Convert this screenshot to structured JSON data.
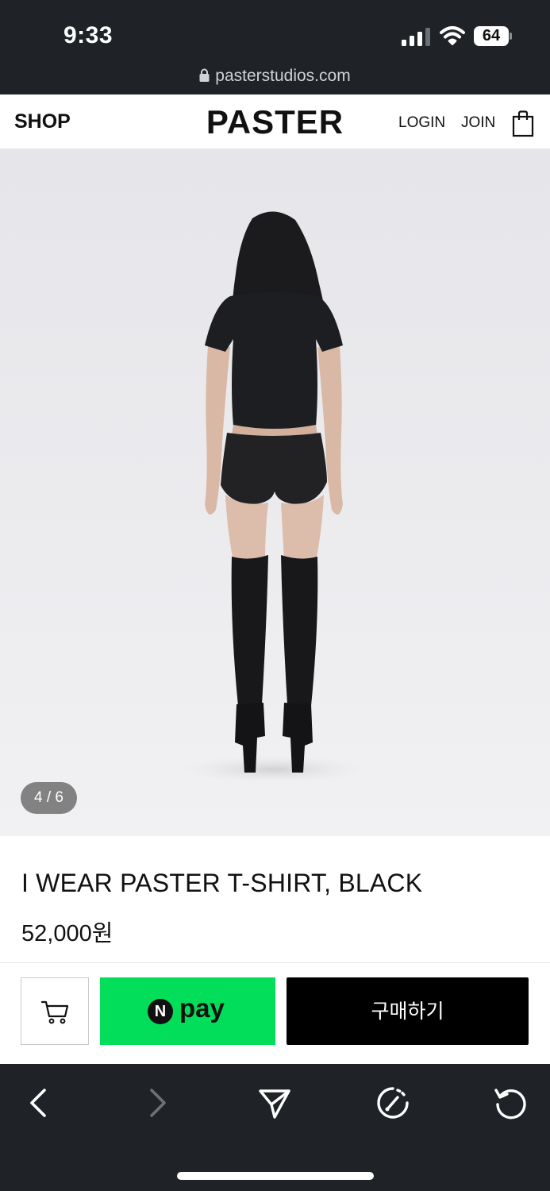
{
  "status_bar": {
    "time": "9:33",
    "battery": "64"
  },
  "browser": {
    "url": "pasterstudios.com"
  },
  "header": {
    "shop_label": "SHOP",
    "brand": "PASTER",
    "login_label": "LOGIN",
    "join_label": "JOIN"
  },
  "gallery": {
    "counter": "4 / 6",
    "current": 4,
    "total": 6
  },
  "product": {
    "title": "I WEAR PASTER T-SHIRT, BLACK",
    "price": "52,000원"
  },
  "purchase_bar": {
    "npay_badge": "N",
    "npay_label": "pay",
    "buy_label": "구매하기",
    "npay_color": "#03de5a"
  },
  "icons": {
    "status": [
      "signal-icon",
      "wifi-icon",
      "battery-icon"
    ],
    "header": [
      "shopping-bag-icon"
    ],
    "toolbar": [
      "back-icon",
      "forward-icon",
      "share-icon",
      "speed-icon",
      "reload-icon"
    ]
  }
}
